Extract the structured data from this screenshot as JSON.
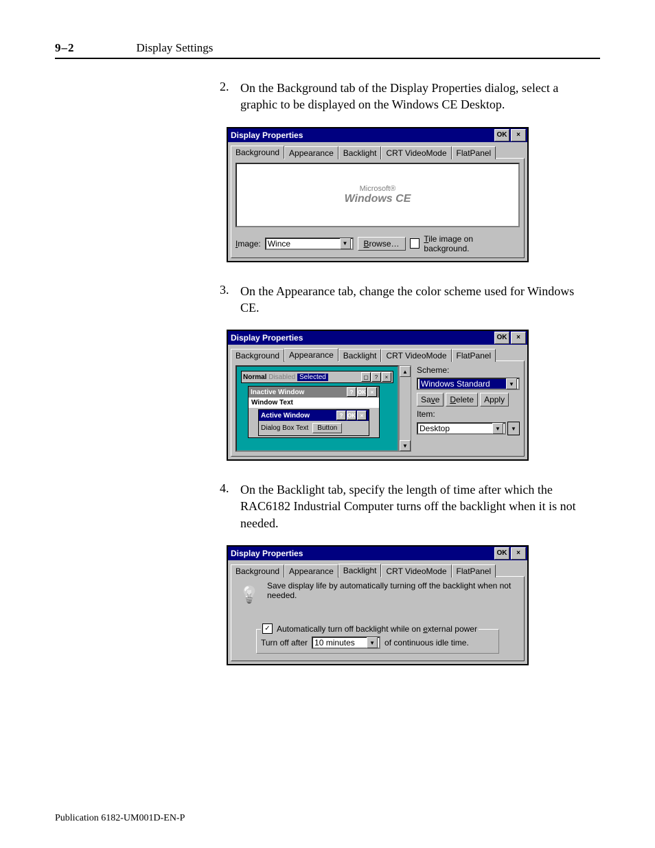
{
  "header": {
    "pageno": "9–2",
    "title": "Display Settings"
  },
  "steps": {
    "s2": {
      "num": "2.",
      "text": "On the Background tab of the Display Properties dialog, select a graphic to be displayed on the Windows CE Desktop."
    },
    "s3": {
      "num": "3.",
      "text": "On the Appearance tab, change the color scheme used for Windows CE."
    },
    "s4": {
      "num": "4.",
      "text": "On the Backlight tab, specify the length of time after which the RAC6182 Industrial Computer turns off the backlight when it is not needed."
    }
  },
  "dlg": {
    "title": "Display Properties",
    "ok": "OK",
    "close": "×",
    "tabs": {
      "bg": "Background",
      "ap": "Appearance",
      "bl": "Backlight",
      "crt": "CRT VideoMode",
      "fp": "FlatPanel"
    }
  },
  "bg": {
    "logo_top": "Microsoft®",
    "logo_main": "Windows CE",
    "image_label": "Image:",
    "image_value": "Wince",
    "browse": "Browse…",
    "tile": "Tile image on background.",
    "image_key": "I",
    "browse_key": "B",
    "tile_key": "T"
  },
  "ap": {
    "normal": "Normal",
    "disabled": "Disabled",
    "selected": "Selected",
    "inactive": "Inactive Window",
    "wintext": "Window Text",
    "active": "Active Window",
    "dlgtext": "Dialog Box Text",
    "button": "Button",
    "scheme_label": "Scheme:",
    "scheme_value": "Windows Standard",
    "save": "Save",
    "save_key": "v",
    "delete": "Delete",
    "delete_key": "D",
    "apply": "Apply",
    "item_label": "Item:",
    "item_value": "Desktop",
    "help": "?",
    "ok": "OK",
    "x": "×"
  },
  "bl": {
    "desc": "Save display life by automatically turning off the backlight when not needed.",
    "auto": "Automatically turn off backlight while on external power",
    "auto_key": "e",
    "turn_off": "Turn off after",
    "duration": "10 minutes",
    "idle": "of continuous idle time."
  },
  "footer": "Publication 6182-UM001D-EN-P"
}
